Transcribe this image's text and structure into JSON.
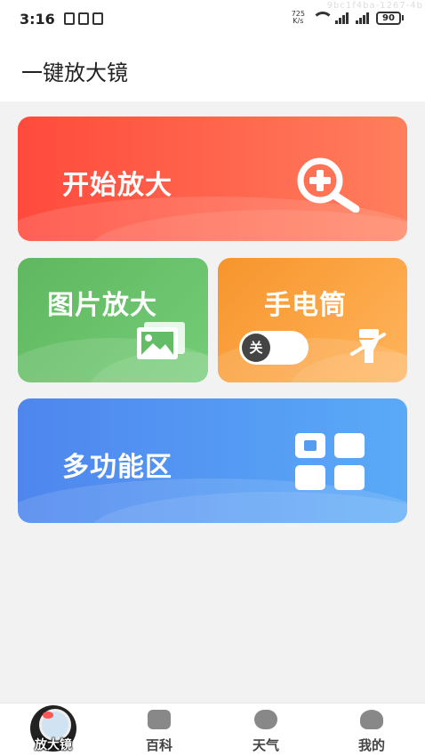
{
  "status_bar": {
    "time": "3:16",
    "net_speed_value": "725",
    "net_speed_unit": "K/s",
    "battery": "90",
    "watermark": "9bc1f4ba-1267-4b"
  },
  "header": {
    "title": "一键放大镜"
  },
  "cards": {
    "zoom": {
      "label": "开始放大",
      "icon": "zoom-in-icon"
    },
    "photo": {
      "label": "图片放大",
      "icon": "image-icon"
    },
    "torch": {
      "label": "手电筒",
      "toggle_label": "关",
      "icon": "flashlight-off-icon"
    },
    "multi": {
      "label": "多功能区",
      "icon": "grid-icon"
    }
  },
  "tabbar": {
    "items": [
      {
        "label": "放大镜",
        "icon": "magnifier-icon",
        "active": true
      },
      {
        "label": "百科",
        "icon": "book-icon"
      },
      {
        "label": "天气",
        "icon": "cloud-icon"
      },
      {
        "label": "我的",
        "icon": "user-icon"
      }
    ]
  },
  "colors": {
    "zoom_card": "#ff5a45",
    "photo_card": "#62bd66",
    "torch_card": "#f9a040",
    "multi_card": "#549cf3"
  }
}
